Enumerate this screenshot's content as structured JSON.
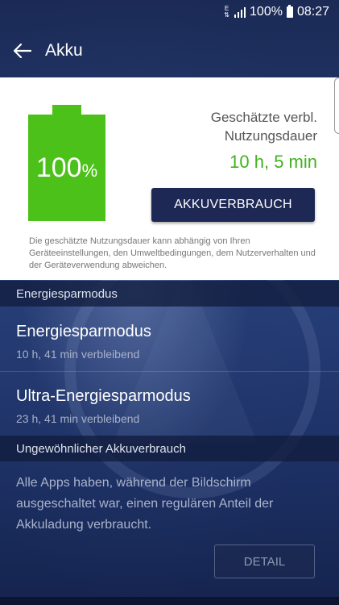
{
  "status_bar": {
    "network": "E",
    "battery_level": "100%",
    "time": "08:27",
    "icons": [
      "network-type-icon",
      "signal-icon",
      "battery-icon"
    ]
  },
  "app_bar": {
    "title": "Akku",
    "back_icon": "back-arrow-icon"
  },
  "battery_card": {
    "percent_value": "100",
    "percent_unit": "%",
    "fill_fraction": 1.0,
    "battery_color": "#4cc11a",
    "estimate_label_line1": "Geschätzte verbl.",
    "estimate_label_line2": "Nutzungsdauer",
    "estimate_value": "10 h, 5 min",
    "estimate_color": "#3fb21f",
    "usage_button": "AKKUVERBRAUCH",
    "disclaimer": "Die geschätzte Nutzungsdauer kann abhängig von Ihren Geräteeinstellungen, den Umweltbedingungen, dem Nutzerverhalten und der Geräteverwendung abweichen."
  },
  "power_saving": {
    "header": "Energiesparmodus",
    "items": [
      {
        "title": "Energiesparmodus",
        "subtitle": "10 h, 41 min verbleibend"
      },
      {
        "title": "Ultra-Energiesparmodus",
        "subtitle": "23 h, 41 min verbleibend"
      }
    ]
  },
  "unusual_usage": {
    "header": "Ungewöhnlicher Akkuverbrauch",
    "text": "Alle Apps haben, während der Bildschirm ausgeschaltet war, einen regulären Anteil der Akkuladung verbraucht.",
    "detail_button": "DETAIL"
  },
  "colors": {
    "accent_dark": "#1d2854",
    "background": "#243562"
  }
}
